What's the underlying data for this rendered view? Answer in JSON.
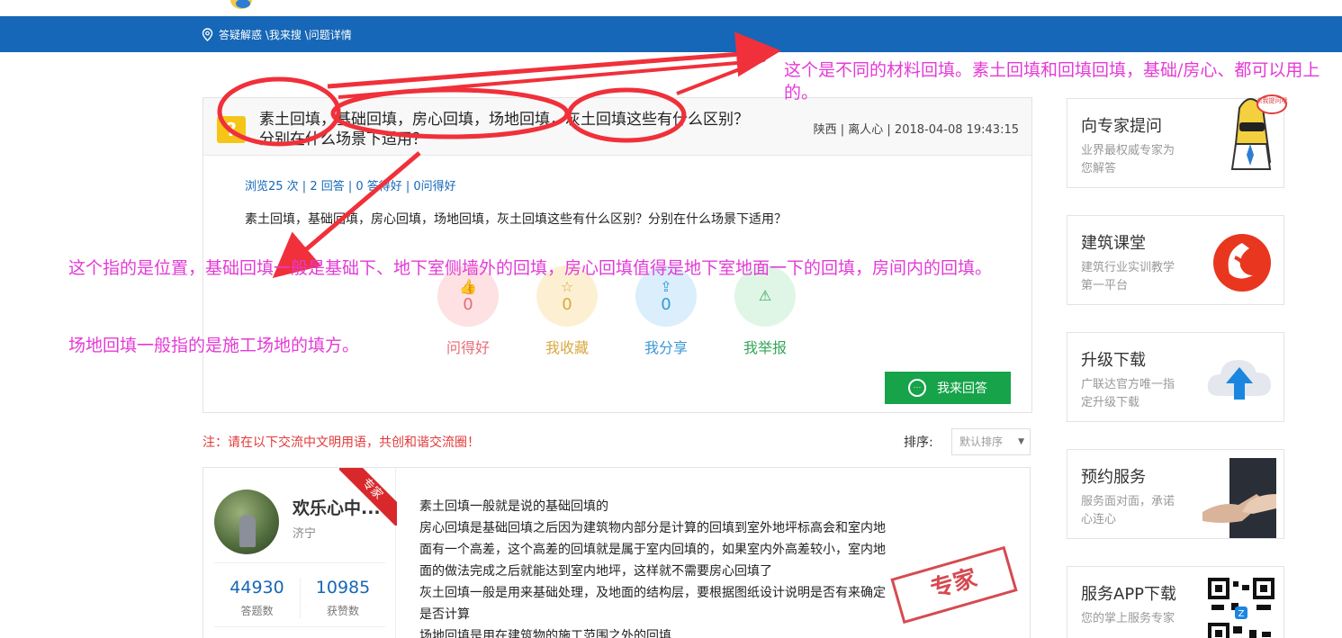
{
  "breadcrumb": {
    "text": "答疑解惑 \\我来搜 \\问题详情"
  },
  "question": {
    "title": "素土回填，基础回填，房心回填，场地回填，灰土回填这些有什么区别？分别在什么场景下适用？",
    "meta": "陕西 | 离人心 | 2018-04-08 19:43:15",
    "stats": "浏览25 次 | 2 回答 | 0 答得好 | 0问得好",
    "body": "素土回填，基础回填，房心回填，场地回填，灰土回填这些有什么区别？分别在什么场景下适用？",
    "icon_label": "?"
  },
  "actions": [
    {
      "label": "问得好",
      "count": "0",
      "icon": "thumbs-up-icon"
    },
    {
      "label": "我收藏",
      "count": "0",
      "icon": "star-icon"
    },
    {
      "label": "我分享",
      "count": "0",
      "icon": "share-icon"
    },
    {
      "label": "我举报",
      "count": "",
      "icon": "warning-icon"
    }
  ],
  "answer_button": {
    "label": "我来回答"
  },
  "notice": "注：请在以下交流中文明用语，共创和谐交流圈！",
  "sort": {
    "label": "排序:",
    "value": "默认排序"
  },
  "answer": {
    "user_name": "欢乐心中...",
    "city": "济宁",
    "badge": "专家",
    "answers_count": "44930",
    "answers_label": "答题数",
    "likes_count": "10985",
    "likes_label": "获赞数",
    "lines": [
      "素土回填一般就是说的基础回填的",
      "房心回填是基础回填之后因为建筑物内部分是计算的回填到室外地坪标高会和室内地",
      "面有一个高差，这个高差的回填就是属于室内回填的，如果室内外高差较小，室内地",
      "面的做法完成之后就能达到室内地坪，这样就不需要房心回填了",
      "灰土回填一般是用来基础处理，及地面的结构层，要根据图纸设计说明是否有来确定",
      "是否计算",
      "场地回填是用在建筑物的施工范围之外的回填"
    ],
    "stamp": "专家"
  },
  "sidebar": [
    {
      "title": "向专家提问",
      "subtitle": "业界最权威专家为您解答",
      "art": "expert-mascot-icon",
      "bubble": "点我提问哦"
    },
    {
      "title": "建筑课堂",
      "subtitle": "建筑行业实训教学第一平台",
      "art": "classroom-logo-icon"
    },
    {
      "title": "升级下载",
      "subtitle": "广联达官方唯一指定升级下载",
      "art": "cloud-upload-icon"
    },
    {
      "title": "预约服务",
      "subtitle": "服务面对面，承诺心连心",
      "art": "handshake-icon"
    },
    {
      "title": "服务APP下载",
      "subtitle": "您的掌上服务专家",
      "art": "qr-code-icon"
    }
  ],
  "annotations": [
    "这个是不同的材料回填。素土回填和回填回填，基础/房心、都可以用上的。",
    "这个指的是位置，基础回填一般是基础下、地下室侧墙外的回填，房心回填值得是地下室地面一下的回填，房间内的回填。",
    "场地回填一般指的是施工场地的填方。"
  ],
  "colors": {
    "nav": "#1667b7",
    "annotation": "#e43ad6",
    "annotation_marks": "#f0303a",
    "answer_button": "#16a34a",
    "notice": "#e2393a"
  }
}
